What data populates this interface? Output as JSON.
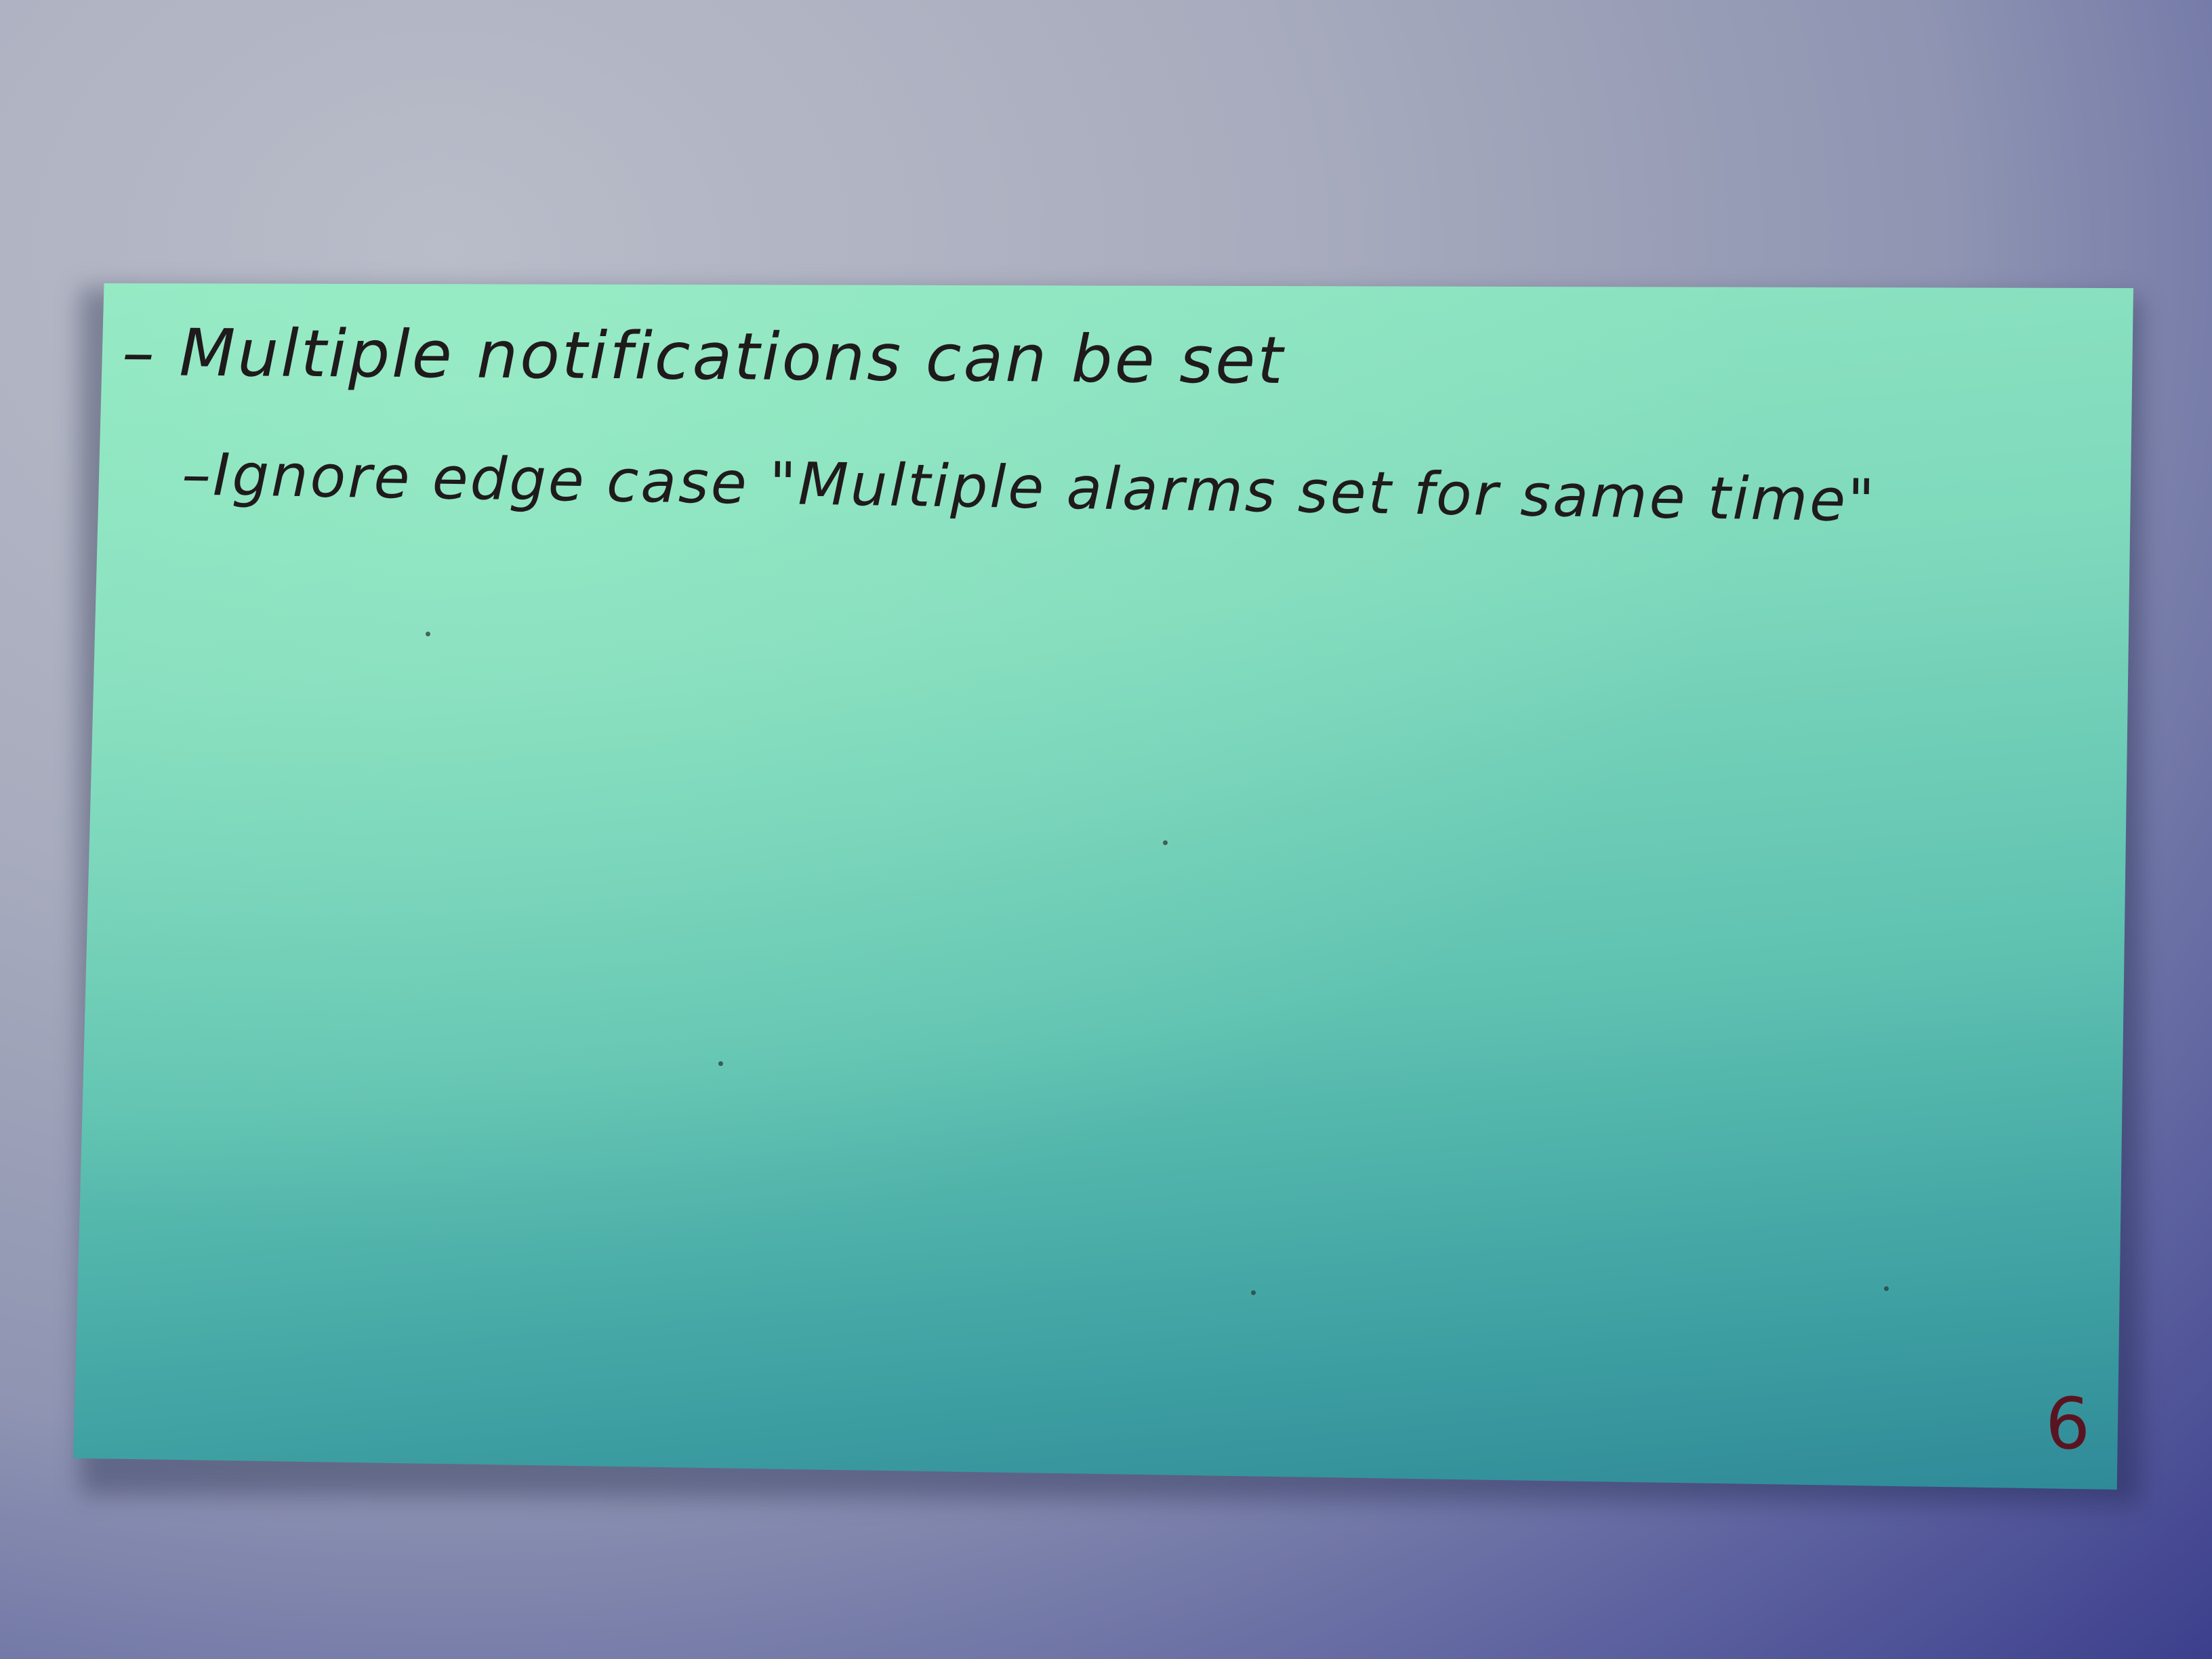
{
  "card": {
    "line_1": "– Multiple notifications can be set",
    "line_2": "–Ignore edge case \"Multiple alarms set for same time\"",
    "page_number": "6"
  }
}
